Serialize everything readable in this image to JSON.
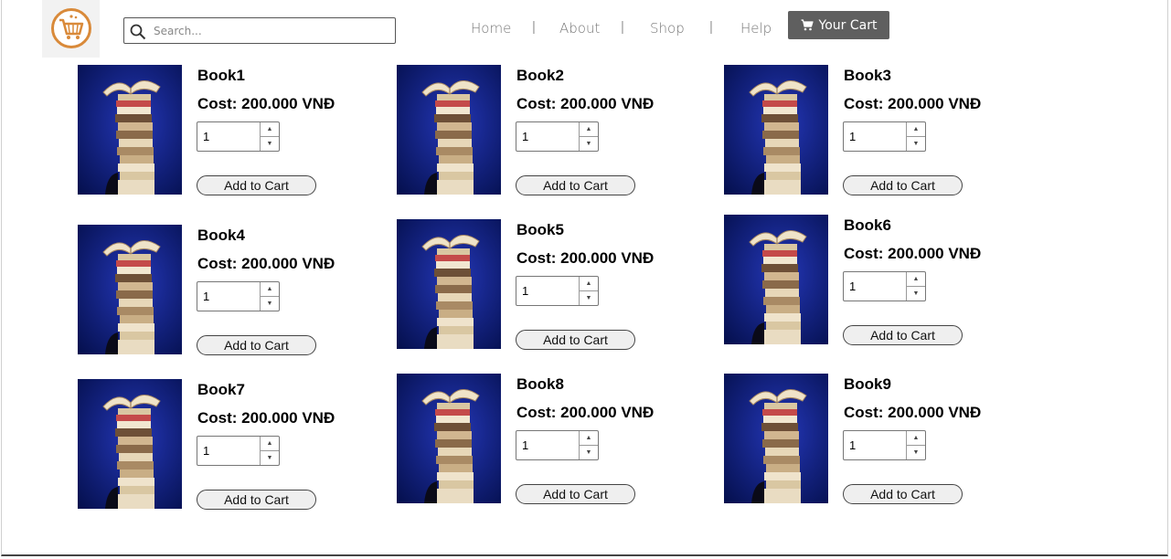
{
  "header": {
    "search": {
      "placeholder": "Search...",
      "value": ""
    },
    "nav": [
      {
        "label": "Home"
      },
      {
        "label": "About"
      },
      {
        "label": "Shop"
      },
      {
        "label": "Help"
      }
    ],
    "separator": "|",
    "cart_label": "Your Cart"
  },
  "products": [
    {
      "name": "Book1",
      "cost": "Cost: 200.000 VNĐ",
      "quantity": "1",
      "button": "Add to Cart"
    },
    {
      "name": "Book2",
      "cost": "Cost: 200.000 VNĐ",
      "quantity": "1",
      "button": "Add to Cart"
    },
    {
      "name": "Book3",
      "cost": "Cost: 200.000 VNĐ",
      "quantity": "1",
      "button": "Add to Cart"
    },
    {
      "name": "Book4",
      "cost": "Cost: 200.000 VNĐ",
      "quantity": "1",
      "button": "Add to Cart"
    },
    {
      "name": "Book5",
      "cost": "Cost: 200.000 VNĐ",
      "quantity": "1",
      "button": "Add to Cart"
    },
    {
      "name": "Book6",
      "cost": "Cost: 200.000 VNĐ",
      "quantity": "1",
      "button": "Add to Cart"
    },
    {
      "name": "Book7",
      "cost": "Cost: 200.000 VNĐ",
      "quantity": "1",
      "button": "Add to Cart"
    },
    {
      "name": "Book8",
      "cost": "Cost: 200.000 VNĐ",
      "quantity": "1",
      "button": "Add to Cart"
    },
    {
      "name": "Book9",
      "cost": "Cost: 200.000 VNĐ",
      "quantity": "1",
      "button": "Add to Cart"
    }
  ],
  "colors": {
    "logo_accent": "#d98a3a",
    "cart_button": "#5f5f5f",
    "thumb_background": "#0a1a6e"
  },
  "icons": {
    "logo": "shopping-cart-logo-icon",
    "search": "search-icon",
    "cart": "cart-icon",
    "thumb": "book-stack-image",
    "spin_up": "spin-up-icon",
    "spin_down": "spin-down-icon"
  }
}
